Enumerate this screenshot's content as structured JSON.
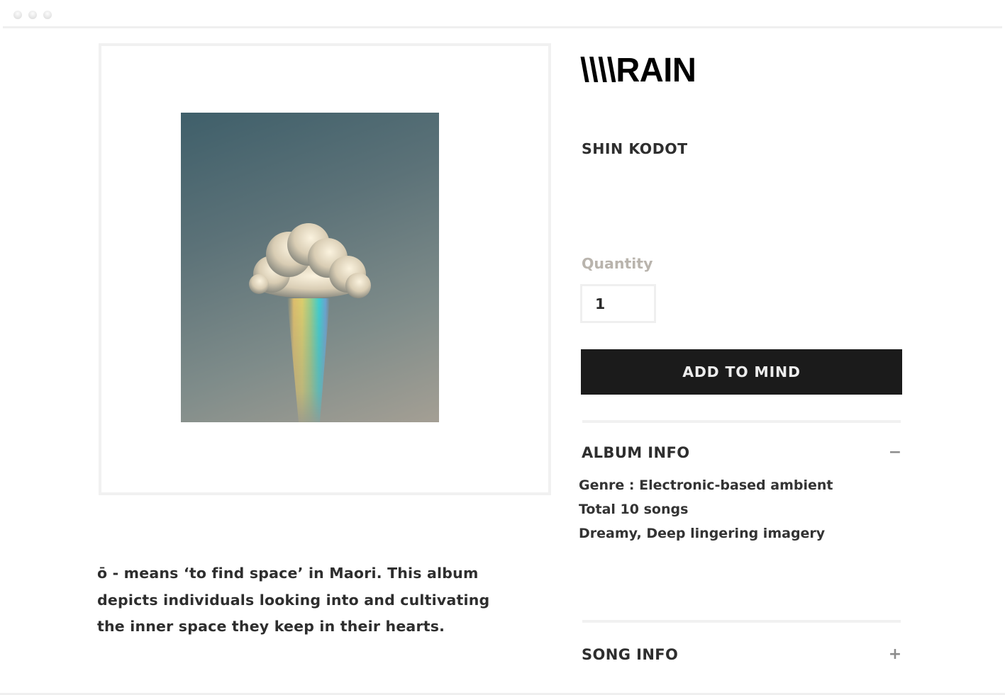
{
  "window": {
    "controls": [
      "close",
      "minimize",
      "maximize"
    ]
  },
  "product": {
    "title": "\\\\\\\\RAIN",
    "artist": "SHIN KODOT",
    "cover_alt": "Album cover: a cloud with a rainbow falling from it",
    "description_lines": [
      "ō - means ‘to find space’ in Maori. This album",
      "depicts individuals looking into and cultivating",
      "the inner space they keep in their hearts."
    ]
  },
  "purchase": {
    "quantity_label": "Quantity",
    "quantity_value": "1",
    "add_button_label": "ADD TO MIND"
  },
  "album_info": {
    "heading": "ALBUM INFO",
    "toggle_symbol": "−",
    "expanded": true,
    "lines": [
      "Genre : Electronic-based ambient",
      "Total 10 songs",
      "Dreamy, Deep lingering imagery"
    ]
  },
  "song_info": {
    "heading": "SONG INFO",
    "toggle_symbol": "+",
    "expanded": false
  },
  "colors": {
    "button_bg": "#1b1b1b",
    "button_text": "#ededed",
    "quantity_label": "#b9b4ad",
    "text": "#2e2e2e",
    "divider": "#f1f1f1"
  }
}
